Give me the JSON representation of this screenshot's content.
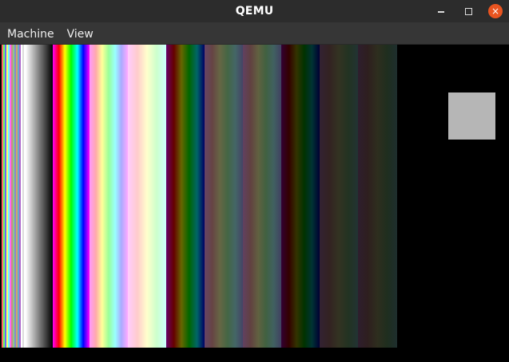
{
  "window": {
    "title": "QEMU"
  },
  "menubar": {
    "items": [
      "Machine",
      "View"
    ]
  },
  "controls": {
    "minimize": "minimize-icon",
    "maximize": "maximize-icon",
    "close": "close-icon",
    "close_color": "#e95420"
  },
  "display": {
    "background": "#000000",
    "cursor_color": "#b6b6b6"
  }
}
